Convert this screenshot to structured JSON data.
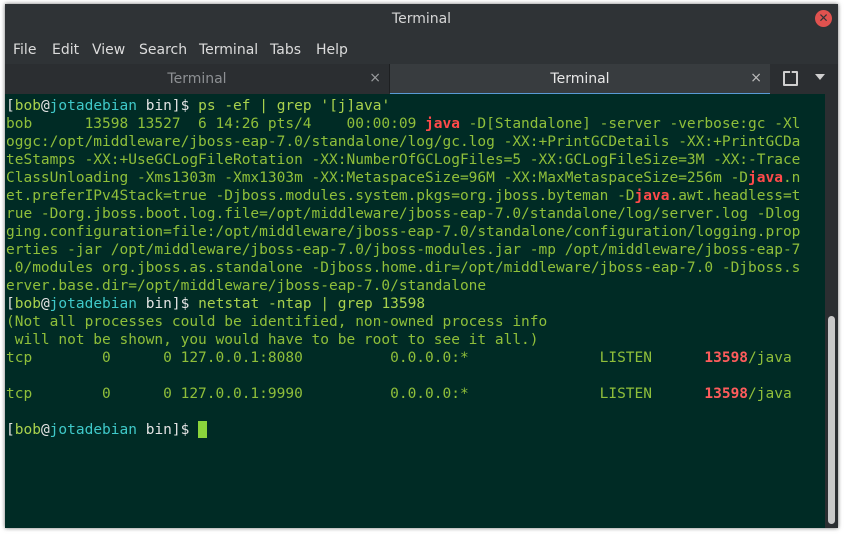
{
  "window": {
    "title": "Terminal",
    "close_icon": "close-icon"
  },
  "menu": [
    "File",
    "Edit",
    "View",
    "Search",
    "Terminal",
    "Tabs",
    "Help"
  ],
  "tabs": [
    {
      "label": "Terminal",
      "active": false
    },
    {
      "label": "Terminal",
      "active": true
    }
  ],
  "tab_close_glyph": "×",
  "prompt": {
    "user": "bob",
    "host": "jotadebian",
    "dir": "bin"
  },
  "commands": [
    "ps -ef | grep '[j]ava'",
    "netstat -ntap | grep 13598"
  ],
  "ps_output": {
    "line1_pre": "bob      13598 13527  6 14:26 pts/4    00:00:09 ",
    "line1_hl": "java",
    "line1_post": " -D[Standalone] -server -verbose:gc -Xl",
    "line2": "oggc:/opt/middleware/jboss-eap-7.0/standalone/log/gc.log -XX:+PrintGCDetails -XX:+PrintGCDa",
    "line3": "teStamps -XX:+UseGCLogFileRotation -XX:NumberOfGCLogFiles=5 -XX:GCLogFileSize=3M -XX:-Trace",
    "line4_pre": "ClassUnloading -Xms1303m -Xmx1303m -XX:MetaspaceSize=96M -XX:MaxMetaspaceSize=256m -D",
    "line4_hl": "java",
    "line4_post": ".n",
    "line5_pre": "et.preferIPv4Stack=true -Djboss.modules.system.pkgs=org.jboss.byteman -D",
    "line5_hl": "java",
    "line5_post": ".awt.headless=t",
    "line6": "rue -Dorg.jboss.boot.log.file=/opt/middleware/jboss-eap-7.0/standalone/log/server.log -Dlog",
    "line7": "ging.configuration=file:/opt/middleware/jboss-eap-7.0/standalone/configuration/logging.prop",
    "line8": "erties -jar /opt/middleware/jboss-eap-7.0/jboss-modules.jar -mp /opt/middleware/jboss-eap-7",
    "line9": ".0/modules org.jboss.as.standalone -Djboss.home.dir=/opt/middleware/jboss-eap-7.0 -Djboss.s",
    "line10": "erver.base.dir=/opt/middleware/jboss-eap-7.0/standalone"
  },
  "netstat_notice": [
    "(Not all processes could be identified, non-owned process info",
    " will not be shown, you would have to be root to see it all.)"
  ],
  "netstat_rows": [
    {
      "pre": "tcp        0      0 127.0.0.1:8080          0.0.0.0:*               LISTEN      ",
      "pid": "13598",
      "post": "/java"
    },
    {
      "pre": "tcp        0      0 127.0.0.1:9990          0.0.0.0:*               LISTEN      ",
      "pid": "13598",
      "post": "/java"
    }
  ]
}
